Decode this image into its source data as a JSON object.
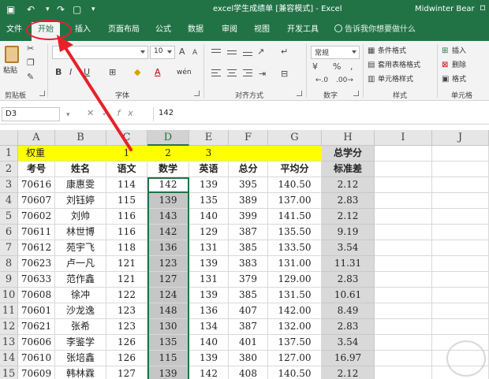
{
  "titlebar": {
    "save_icon": "save-icon",
    "undo_icon": "undo-icon",
    "new_icon": "new-document-icon",
    "title": "excel学生成绩单 [兼容模式] - Excel",
    "user": "Midwinter Bear"
  },
  "tabs": [
    {
      "label": "文件"
    },
    {
      "label": "开始"
    },
    {
      "label": "插入"
    },
    {
      "label": "页面布局"
    },
    {
      "label": "公式"
    },
    {
      "label": "数据"
    },
    {
      "label": "审阅"
    },
    {
      "label": "视图"
    },
    {
      "label": "开发工具"
    }
  ],
  "active_tab": "开始",
  "tell_me": "告诉我你想要做什么",
  "ribbon": {
    "paste_label": "粘贴",
    "clipboard_label": "剪贴板",
    "font_label": "字体",
    "font_size": "10",
    "grow_font": "A",
    "shrink_font": "A",
    "bold": "B",
    "italic": "I",
    "underline": "U",
    "wen": "wén",
    "font_color_letter": "A",
    "align_label": "对齐方式",
    "number_format": "常规",
    "number_label": "数字",
    "percent": "%",
    "comma": ",",
    "cond_format": "条件格式",
    "table_format": "套用表格格式",
    "cell_style": "单元格样式",
    "styles_label": "样式",
    "insert": "插入",
    "delete": "删除",
    "format": "格式",
    "cells_label": "单元格"
  },
  "formula_bar": {
    "name_box": "D3",
    "cancel": "✕",
    "confirm": "✓",
    "fx": "fx",
    "value": "142"
  },
  "columns": [
    "A",
    "B",
    "C",
    "D",
    "E",
    "F",
    "G",
    "H",
    "I",
    "J"
  ],
  "selected_column": "D",
  "rows": [
    "1",
    "2",
    "3",
    "4",
    "5",
    "6",
    "7",
    "8",
    "9",
    "10",
    "11",
    "12",
    "13",
    "14",
    "15"
  ],
  "sheet": {
    "row1": {
      "A": "权重",
      "C": "1",
      "D": "2",
      "E": "3",
      "H": "总学分"
    },
    "headers": [
      "考号",
      "姓名",
      "语文",
      "数学",
      "英语",
      "总分",
      "平均分",
      "标准差"
    ],
    "data": [
      [
        "70616",
        "康惠雯",
        "114",
        "142",
        "139",
        "395",
        "140.50",
        "2.12"
      ],
      [
        "70607",
        "刘钰婷",
        "115",
        "139",
        "135",
        "389",
        "137.00",
        "2.83"
      ],
      [
        "70602",
        "刘帅",
        "116",
        "143",
        "140",
        "399",
        "141.50",
        "2.12"
      ],
      [
        "70611",
        "林世博",
        "116",
        "142",
        "129",
        "387",
        "135.50",
        "9.19"
      ],
      [
        "70612",
        "苑宇飞",
        "118",
        "136",
        "131",
        "385",
        "133.50",
        "3.54"
      ],
      [
        "70623",
        "卢一凡",
        "121",
        "123",
        "139",
        "383",
        "131.00",
        "11.31"
      ],
      [
        "70633",
        "范作鑫",
        "121",
        "127",
        "131",
        "379",
        "129.00",
        "2.83"
      ],
      [
        "70608",
        "徐冲",
        "122",
        "124",
        "139",
        "385",
        "131.50",
        "10.61"
      ],
      [
        "70601",
        "沙龙逸",
        "123",
        "148",
        "136",
        "407",
        "142.00",
        "8.49"
      ],
      [
        "70621",
        "张希",
        "123",
        "130",
        "134",
        "387",
        "132.00",
        "2.83"
      ],
      [
        "70606",
        "李鉴学",
        "126",
        "135",
        "140",
        "401",
        "137.50",
        "3.54"
      ],
      [
        "70610",
        "张培鑫",
        "126",
        "115",
        "139",
        "380",
        "127.00",
        "16.97"
      ],
      [
        "70609",
        "韩林霖",
        "127",
        "139",
        "142",
        "408",
        "140.50",
        "2.12"
      ]
    ]
  },
  "colors": {
    "excel_green": "#217346",
    "weight_row": "#ffff00",
    "annotation_red": "#e8202a"
  }
}
